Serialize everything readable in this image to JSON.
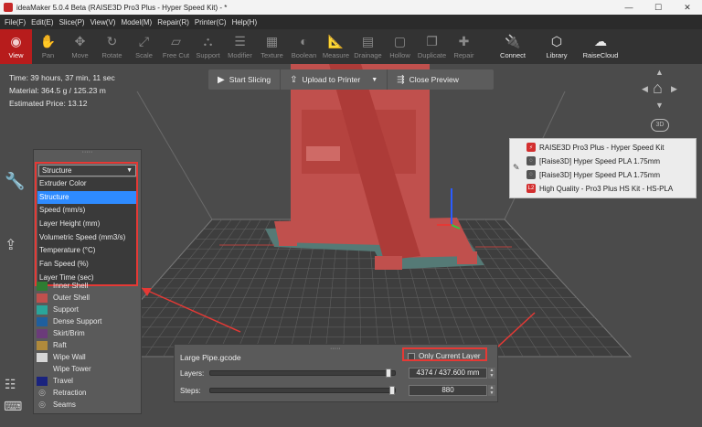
{
  "window": {
    "title": "ideaMaker 5.0.4 Beta (RAISE3D Pro3 Plus - Hyper Speed Kit) - *",
    "minimize": "—",
    "maximize": "☐",
    "close": "✕"
  },
  "menu": [
    "File(F)",
    "Edit(E)",
    "Slice(P)",
    "View(V)",
    "Model(M)",
    "Repair(R)",
    "Printer(C)",
    "Help(H)"
  ],
  "toolbar": [
    {
      "label": "View",
      "icon": "eye-icon",
      "glyph": "◉"
    },
    {
      "label": "Pan",
      "icon": "hand-icon",
      "glyph": "✋"
    },
    {
      "label": "Move",
      "icon": "move-icon",
      "glyph": "✥"
    },
    {
      "label": "Rotate",
      "icon": "rotate-icon",
      "glyph": "↻"
    },
    {
      "label": "Scale",
      "icon": "scale-icon",
      "glyph": "⤢"
    },
    {
      "label": "Free Cut",
      "icon": "cut-icon",
      "glyph": "▱"
    },
    {
      "label": "Support",
      "icon": "support-icon",
      "glyph": "⛬"
    },
    {
      "label": "Modifier",
      "icon": "modifier-icon",
      "glyph": "☰"
    },
    {
      "label": "Texture",
      "icon": "texture-icon",
      "glyph": "▦"
    },
    {
      "label": "Boolean",
      "icon": "boolean-icon",
      "glyph": "◐"
    },
    {
      "label": "Measure",
      "icon": "measure-icon",
      "glyph": "📐"
    },
    {
      "label": "Drainage",
      "icon": "drainage-icon",
      "glyph": "▤"
    },
    {
      "label": "Hollow",
      "icon": "hollow-icon",
      "glyph": "▢"
    },
    {
      "label": "Duplicate",
      "icon": "duplicate-icon",
      "glyph": "❐"
    },
    {
      "label": "Repair",
      "icon": "repair-icon",
      "glyph": "✚"
    }
  ],
  "toolbar_right": [
    {
      "label": "Connect",
      "icon": "connect-icon",
      "glyph": "🔌"
    },
    {
      "label": "Library",
      "icon": "library-icon",
      "glyph": "⬡"
    },
    {
      "label": "RaiseCloud",
      "icon": "cloud-icon",
      "glyph": "☁"
    }
  ],
  "info": {
    "time": "Time: 39 hours, 37 min, 11 sec",
    "material": "Material: 364.5 g / 125.23 m",
    "price": "Estimated Price: 13.12"
  },
  "slicebar": {
    "start": "Start Slicing",
    "upload": "Upload to Printer",
    "close": "Close Preview"
  },
  "navcube": {
    "label": "3D"
  },
  "dropdown": {
    "selected": "Structure",
    "options": [
      "Extruder Color",
      "Structure",
      "Speed (mm/s)",
      "Layer Height (mm)",
      "Volumetric Speed (mm3/s)",
      "Temperature (°C)",
      "Fan Speed (%)",
      "Layer Time (sec)"
    ],
    "highlighted_index": 1
  },
  "legend": [
    {
      "label": "Inner Shell",
      "color": "#2e7d32",
      "type": "swatch"
    },
    {
      "label": "Outer Shell",
      "color": "#c0504d",
      "type": "swatch"
    },
    {
      "label": "Support",
      "color": "#2aa59a",
      "type": "swatch"
    },
    {
      "label": "Dense Support",
      "color": "#1f5f9e",
      "type": "swatch"
    },
    {
      "label": "Skirt/Brim",
      "color": "#6b3b7a",
      "type": "swatch"
    },
    {
      "label": "Raft",
      "color": "#b08a3c",
      "type": "swatch"
    },
    {
      "label": "Wipe Wall",
      "color": "#d6d6d6",
      "type": "swatch"
    },
    {
      "label": "Wipe Tower",
      "color": "#5a5a5a",
      "type": "swatch"
    },
    {
      "label": "Travel",
      "color": "#1a237e",
      "type": "swatch"
    },
    {
      "label": "Retraction",
      "color": "#bbbbbb",
      "type": "eye"
    },
    {
      "label": "Seams",
      "color": "#bbbbbb",
      "type": "eye"
    }
  ],
  "bottom": {
    "file": "Large Pipe.gcode",
    "only_current": "Only Current Layer",
    "layers_label": "Layers:",
    "layers_value": "4374 / 437.600 mm",
    "layers_fraction": 0.98,
    "steps_label": "Steps:",
    "steps_value": "880",
    "steps_fraction": 1.0
  },
  "printer_panel": [
    {
      "label": "RAISE3D Pro3 Plus - Hyper Speed Kit",
      "icon": "raise3d-icon",
      "color": "#d32f2f",
      "glyph": "⚡"
    },
    {
      "label": "[Raise3D] Hyper Speed PLA 1.75mm",
      "icon": "filament-icon",
      "color": "#555555",
      "glyph": "◌"
    },
    {
      "label": "[Raise3D] Hyper Speed PLA 1.75mm",
      "icon": "filament-icon",
      "color": "#555555",
      "glyph": "◌"
    },
    {
      "label": "High Quality - Pro3 Plus HS Kit - HS-PLA",
      "icon": "profile-icon",
      "color": "#d32f2f",
      "glyph": "L2"
    }
  ],
  "colors": {
    "accent": "#b71c1c",
    "highlight": "#e53935",
    "model": "#c0504d"
  }
}
